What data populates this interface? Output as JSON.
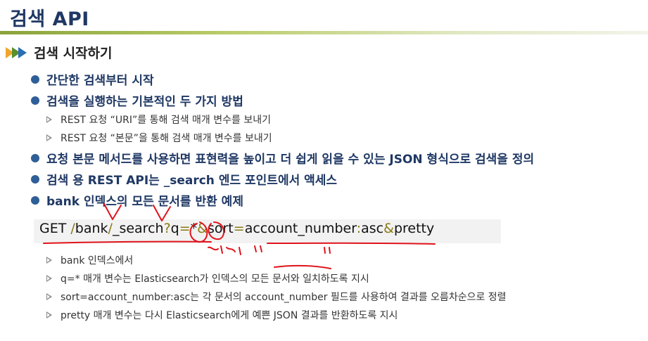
{
  "slide": {
    "title": "검색 API",
    "section": "검색 시작하기",
    "bullets": [
      "간단한 검색부터 시작",
      "검색을 실행하는 기본적인 두 가지 방법",
      "요청 본문 메서드를 사용하면 표현력을 높이고 더 쉽게 읽을 수 있는 JSON 형식으로 검색을 정의",
      "검색 용 REST API는 _search 엔드 포인트에서 액세스",
      "bank 인덱스의 모든 문서를 반환 예제"
    ],
    "sub_bullets_methods": [
      "REST 요청 “URI”를 통해 검색 매개 변수를 보내기",
      "REST 요청 “본문”을 통해 검색 매개 변수를 보내기"
    ],
    "code": {
      "method": "GET ",
      "s1": "/",
      "p1": "bank",
      "s2": "/",
      "p2": "_search",
      "s3": "?",
      "k1": "q",
      "s4": "=",
      "v1": "*",
      "s5": "&",
      "k2": "sort",
      "s6": "=",
      "v2": "account_number",
      "s7": ":",
      "v3": "asc",
      "s8": "&",
      "k3": "pretty"
    },
    "explanations": [
      "bank 인덱스에서",
      "q=* 매개 변수는 Elasticsearch가 인덱스의 모든 문서와 일치하도록 지시",
      "sort=account_number:asc는 각 문서의 account_number 필드를 사용하여 결과를 오름차순으로 정렬",
      "pretty 매개 변수는 다시 Elasticsearch에게 예쁜 JSON 결과를 반환하도록 지시"
    ],
    "annotation_color": "#e0131b",
    "title_color": "#1f3864",
    "separator_color": "#8a7a12"
  }
}
